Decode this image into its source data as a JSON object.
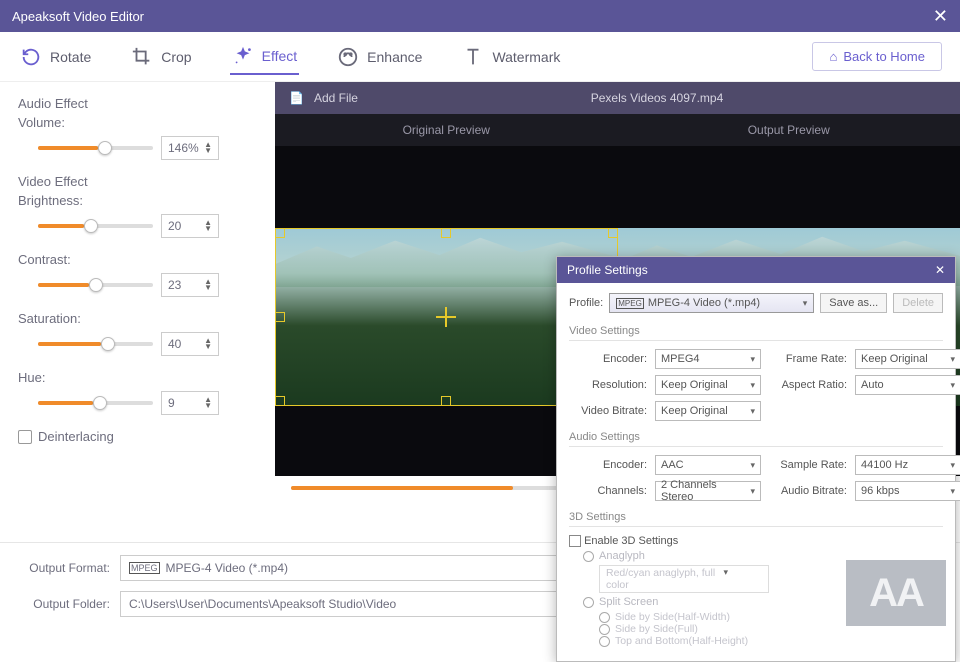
{
  "app_title": "Apeaksoft Video Editor",
  "toolbar": {
    "rotate": "Rotate",
    "crop": "Crop",
    "effect": "Effect",
    "enhance": "Enhance",
    "watermark": "Watermark",
    "back_home": "Back to Home"
  },
  "sidebar": {
    "audio_effect": "Audio Effect",
    "volume_label": "Volume:",
    "volume_value": "146%",
    "video_effect": "Video Effect",
    "brightness_label": "Brightness:",
    "brightness_value": "20",
    "contrast_label": "Contrast:",
    "contrast_value": "23",
    "saturation_label": "Saturation:",
    "saturation_value": "40",
    "hue_label": "Hue:",
    "hue_value": "9",
    "deinterlacing": "Deinterlacing"
  },
  "preview": {
    "add_file": "Add File",
    "filename": "Pexels Videos 4097.mp4",
    "original": "Original Preview",
    "output": "Output Preview"
  },
  "footer": {
    "output_format_label": "Output Format:",
    "output_format_value": "MPEG-4 Video (*.mp4)",
    "output_folder_label": "Output Folder:",
    "output_folder_value": "C:\\Users\\User\\Documents\\Apeaksoft Studio\\Video"
  },
  "dialog": {
    "title": "Profile Settings",
    "profile_label": "Profile:",
    "profile_value": "MPEG-4 Video (*.mp4)",
    "save_as": "Save as...",
    "delete": "Delete",
    "video_settings": "Video Settings",
    "encoder_label": "Encoder:",
    "video_encoder": "MPEG4",
    "resolution_label": "Resolution:",
    "resolution": "Keep Original",
    "video_bitrate_label": "Video Bitrate:",
    "video_bitrate": "Keep Original",
    "frame_rate_label": "Frame Rate:",
    "frame_rate": "Keep Original",
    "aspect_ratio_label": "Aspect Ratio:",
    "aspect_ratio": "Auto",
    "audio_settings": "Audio Settings",
    "audio_encoder": "AAC",
    "channels_label": "Channels:",
    "channels": "2 Channels Stereo",
    "sample_rate_label": "Sample Rate:",
    "sample_rate": "44100 Hz",
    "audio_bitrate_label": "Audio Bitrate:",
    "audio_bitrate": "96 kbps",
    "three_d": "3D Settings",
    "enable_3d": "Enable 3D Settings",
    "anaglyph": "Anaglyph",
    "anaglyph_opt": "Red/cyan anaglyph, full color",
    "split_screen": "Split Screen",
    "side_half": "Side by Side(Half-Width)",
    "side_full": "Side by Side(Full)",
    "top_bottom": "Top and Bottom(Half-Height)"
  },
  "logo": "AA"
}
